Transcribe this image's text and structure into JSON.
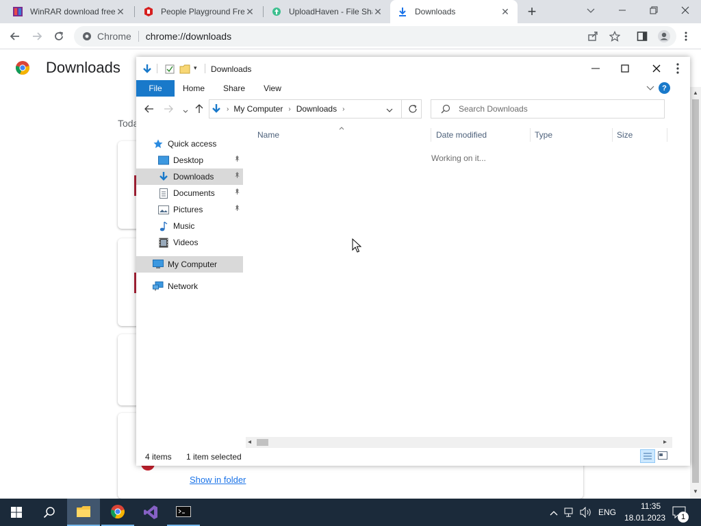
{
  "browser": {
    "tabs": [
      {
        "title": "WinRAR download free and support: WinRAR",
        "icon": "winrar-icon"
      },
      {
        "title": "People Playground Free Download",
        "icon": "people-playground-icon"
      },
      {
        "title": "UploadHaven - File Sharing",
        "icon": "uploadhaven-icon"
      },
      {
        "title": "Downloads",
        "icon": "download-icon",
        "active": true
      }
    ],
    "new_tab_symbol": "+",
    "close_symbol": "✕",
    "omnibox_site": "Chrome",
    "omnibox_url": "chrome://downloads"
  },
  "downloads_page": {
    "title": "Downloads",
    "section_label": "Toda",
    "show_in_folder": "Show in folder"
  },
  "explorer": {
    "title": "Downloads",
    "ribbon_tabs": [
      "File",
      "Home",
      "Share",
      "View"
    ],
    "breadcrumb": [
      "My Computer",
      "Downloads"
    ],
    "search_placeholder": "Search Downloads",
    "nav": {
      "quick_access": "Quick access",
      "items": [
        {
          "label": "Desktop",
          "icon": "desktop-icon",
          "pinned": true
        },
        {
          "label": "Downloads",
          "icon": "download-arrow-icon",
          "pinned": true,
          "selected": true
        },
        {
          "label": "Documents",
          "icon": "documents-icon",
          "pinned": true
        },
        {
          "label": "Pictures",
          "icon": "pictures-icon",
          "pinned": true
        },
        {
          "label": "Music",
          "icon": "music-icon"
        },
        {
          "label": "Videos",
          "icon": "videos-icon"
        }
      ],
      "my_computer": "My Computer",
      "network": "Network"
    },
    "columns": [
      "Name",
      "Date modified",
      "Type",
      "Size"
    ],
    "status_message": "Working on it...",
    "status_bar": {
      "items": "4 items",
      "selected": "1 item selected"
    }
  },
  "taskbar": {
    "language": "ENG",
    "time": "11:35",
    "date": "18.01.2023",
    "notification_count": "1"
  },
  "colors": {
    "chrome_tabstrip": "#dee1e6",
    "explorer_file_tab": "#1979ca",
    "selection": "#cce8ff",
    "taskbar": "#1b2a3a"
  }
}
